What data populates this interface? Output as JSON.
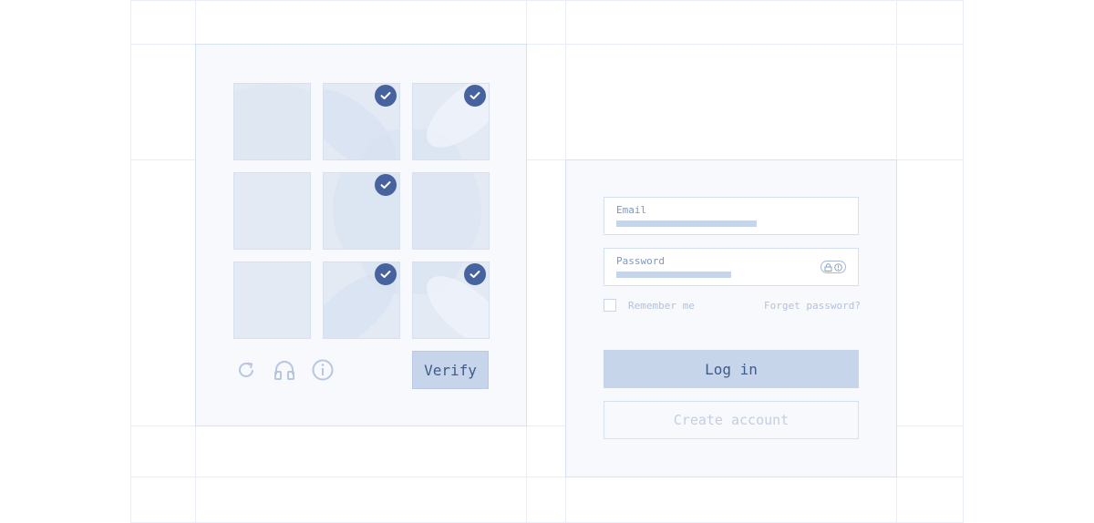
{
  "captcha": {
    "tiles": [
      {
        "id": "r1c1",
        "selected": false
      },
      {
        "id": "r1c2",
        "selected": true
      },
      {
        "id": "r1c3",
        "selected": true
      },
      {
        "id": "r2c1",
        "selected": false
      },
      {
        "id": "r2c2",
        "selected": true
      },
      {
        "id": "r2c3",
        "selected": false
      },
      {
        "id": "r3c1",
        "selected": false
      },
      {
        "id": "r3c2",
        "selected": true
      },
      {
        "id": "r3c3",
        "selected": true
      }
    ],
    "controls": [
      "refresh-icon",
      "headphones-icon",
      "info-icon"
    ],
    "verify_label": "Verify"
  },
  "login": {
    "email_label": "Email",
    "password_label": "Password",
    "remember_label": "Remember me",
    "forgot_label": "Forget password?",
    "login_label": "Log in",
    "create_label": "Create account"
  },
  "colors": {
    "accent": "#46629f",
    "button_fill": "#c6d5ea",
    "panel_bg": "#f7f9fc",
    "tile_bg": "#e3eaf4"
  }
}
